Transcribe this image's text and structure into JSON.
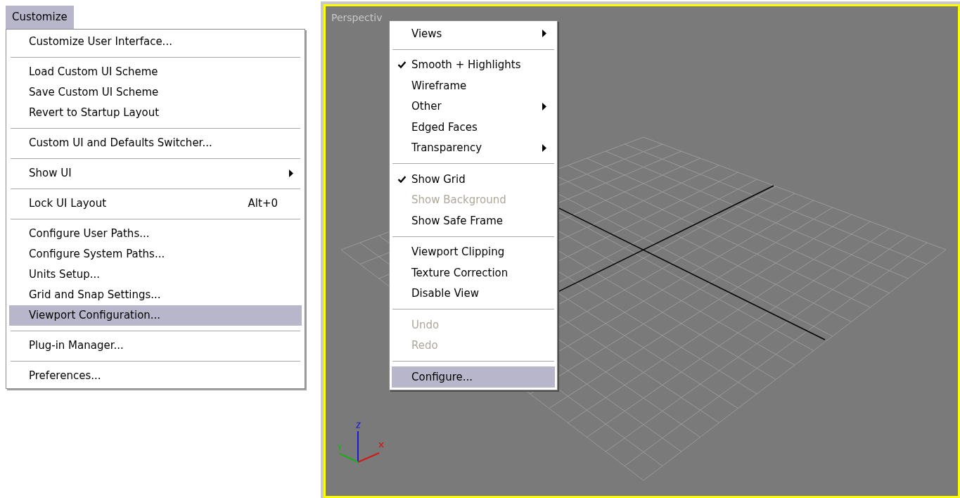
{
  "customize_menu": {
    "title": "Customize",
    "open": true,
    "items": [
      {
        "kind": "item",
        "label": "Customize User Interface...",
        "selected": false
      },
      {
        "kind": "separator"
      },
      {
        "kind": "item",
        "label": "Load Custom UI Scheme",
        "selected": false
      },
      {
        "kind": "item",
        "label": "Save Custom UI Scheme",
        "selected": false
      },
      {
        "kind": "item",
        "label": "Revert to Startup Layout",
        "selected": false
      },
      {
        "kind": "separator"
      },
      {
        "kind": "item",
        "label": "Custom UI and Defaults Switcher...",
        "selected": false
      },
      {
        "kind": "separator"
      },
      {
        "kind": "item",
        "label": "Show UI",
        "submenu": true,
        "selected": false
      },
      {
        "kind": "separator"
      },
      {
        "kind": "item",
        "label": "Lock UI Layout",
        "shortcut": "Alt+0",
        "selected": false
      },
      {
        "kind": "separator"
      },
      {
        "kind": "item",
        "label": "Configure User Paths...",
        "selected": false
      },
      {
        "kind": "item",
        "label": "Configure System Paths...",
        "selected": false
      },
      {
        "kind": "item",
        "label": "Units Setup...",
        "selected": false
      },
      {
        "kind": "item",
        "label": "Grid and Snap Settings...",
        "selected": false
      },
      {
        "kind": "item",
        "label": "Viewport Configuration...",
        "selected": true
      },
      {
        "kind": "separator"
      },
      {
        "kind": "item",
        "label": "Plug-in Manager...",
        "selected": false
      },
      {
        "kind": "separator"
      },
      {
        "kind": "item",
        "label": "Preferences...",
        "selected": false
      }
    ]
  },
  "viewport": {
    "label": "Perspectiv",
    "active": true,
    "context_menu": {
      "items": [
        {
          "kind": "item",
          "label": "Views",
          "submenu": true,
          "checked": false,
          "disabled": false,
          "selected": false
        },
        {
          "kind": "separator"
        },
        {
          "kind": "item",
          "label": "Smooth + Highlights",
          "checked": true,
          "disabled": false,
          "selected": false
        },
        {
          "kind": "item",
          "label": "Wireframe",
          "checked": false,
          "disabled": false,
          "selected": false
        },
        {
          "kind": "item",
          "label": "Other",
          "submenu": true,
          "checked": false,
          "disabled": false,
          "selected": false
        },
        {
          "kind": "item",
          "label": "Edged Faces",
          "checked": false,
          "disabled": false,
          "selected": false
        },
        {
          "kind": "item",
          "label": "Transparency",
          "submenu": true,
          "checked": false,
          "disabled": false,
          "selected": false
        },
        {
          "kind": "separator"
        },
        {
          "kind": "item",
          "label": "Show Grid",
          "checked": true,
          "disabled": false,
          "selected": false
        },
        {
          "kind": "item",
          "label": "Show Background",
          "checked": false,
          "disabled": true,
          "selected": false
        },
        {
          "kind": "item",
          "label": "Show Safe Frame",
          "checked": false,
          "disabled": false,
          "selected": false
        },
        {
          "kind": "separator"
        },
        {
          "kind": "item",
          "label": "Viewport Clipping",
          "checked": false,
          "disabled": false,
          "selected": false
        },
        {
          "kind": "item",
          "label": "Texture Correction",
          "checked": false,
          "disabled": false,
          "selected": false
        },
        {
          "kind": "item",
          "label": "Disable View",
          "checked": false,
          "disabled": false,
          "selected": false
        },
        {
          "kind": "separator"
        },
        {
          "kind": "item",
          "label": "Undo",
          "checked": false,
          "disabled": true,
          "selected": false
        },
        {
          "kind": "item",
          "label": "Redo",
          "checked": false,
          "disabled": true,
          "selected": false
        },
        {
          "kind": "separator"
        },
        {
          "kind": "item",
          "label": "Configure...",
          "checked": false,
          "disabled": false,
          "selected": true
        }
      ]
    }
  }
}
